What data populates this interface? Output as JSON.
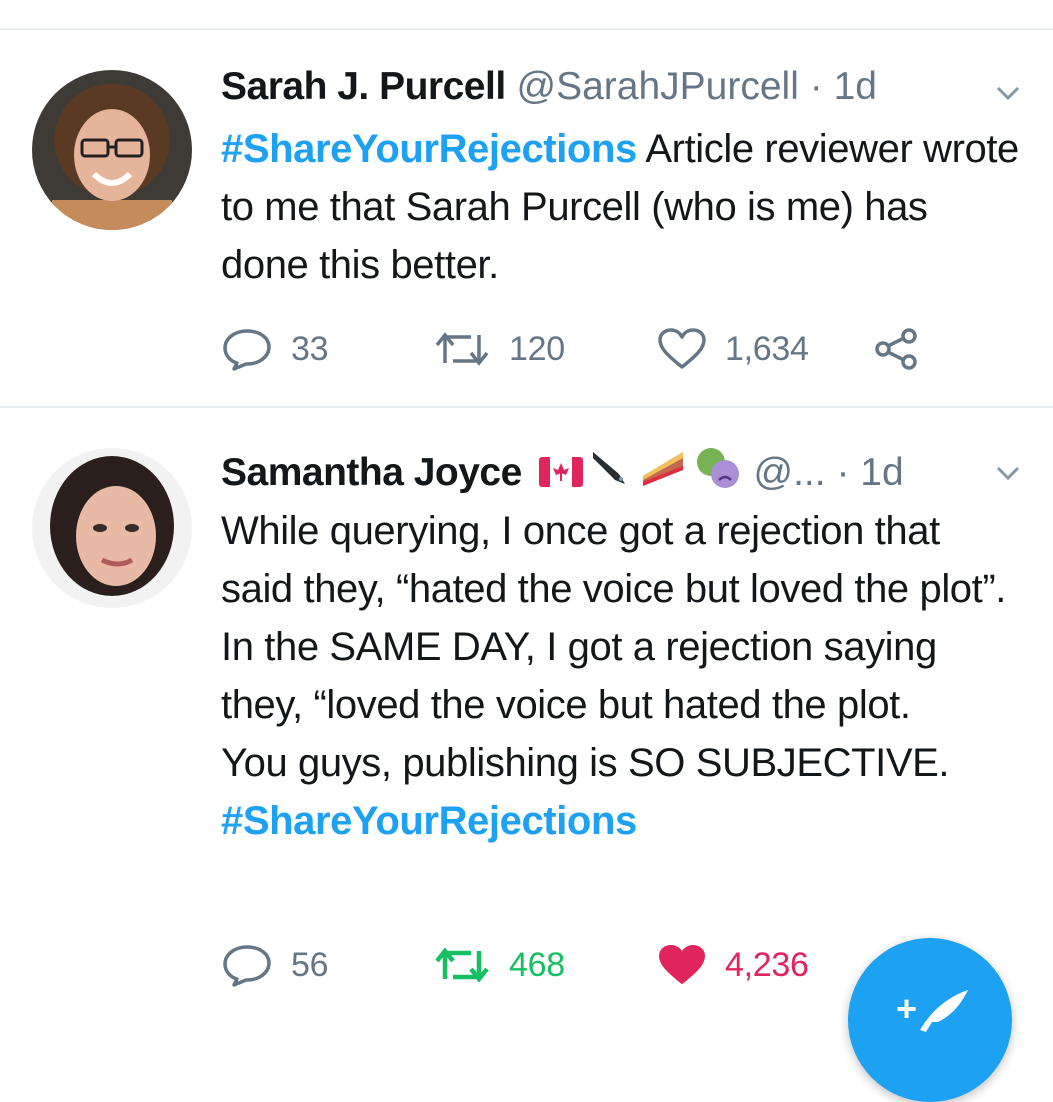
{
  "tweets": [
    {
      "name": "Sarah J. Purcell",
      "handle": "@SarahJPurcell",
      "separator": "·",
      "time": "1d",
      "hashtag": "#ShareYourRejections",
      "text_after_hashtag": " Article reviewer wrote to me that Sarah Purcell (who is me) has done this better.",
      "replies": "33",
      "retweets": "120",
      "likes": "1,634",
      "liked": false,
      "retweeted": false
    },
    {
      "name": "Samantha Joyce",
      "name_emojis": [
        "canada-flag-icon",
        "fountain-pen-icon",
        "pie-icon",
        "theater-masks-icon"
      ],
      "handle": "@...",
      "separator": "·",
      "time": "1d",
      "lines": [
        "While querying, I once got a rejection that said they, “hated the voice but loved the plot”. In the SAME DAY, I got a rejection saying they, “loved the voice but hated the plot.",
        "You guys, publishing is SO SUBJECTIVE."
      ],
      "hashtag": "#ShareYourRejections",
      "replies": "56",
      "retweets": "468",
      "likes": "4,236",
      "liked": true,
      "retweeted": true
    }
  ],
  "colors": {
    "accent": "#1da1f2",
    "retweet_active": "#17bf63",
    "like_active": "#e0245e",
    "muted": "#657786",
    "divider": "#e6ecf0"
  },
  "fab": {
    "icon": "compose-tweet-icon",
    "plus": "+"
  }
}
